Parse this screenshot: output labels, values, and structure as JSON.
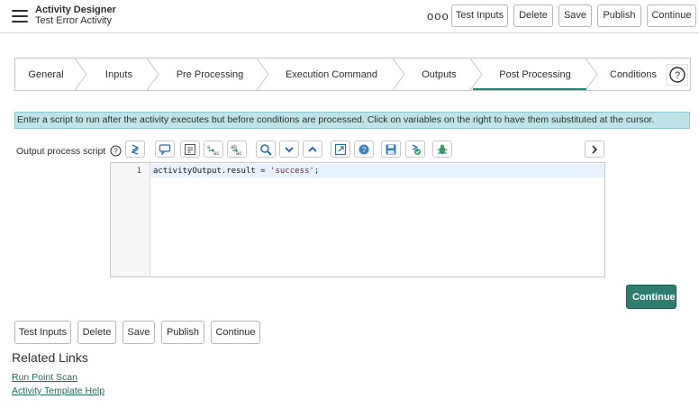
{
  "header": {
    "app_title": "Activity Designer",
    "record_title": "Test Error Activity",
    "more_label": "ooo",
    "buttons": {
      "test_inputs": "Test Inputs",
      "delete": "Delete",
      "save": "Save",
      "publish": "Publish",
      "continue": "Continue"
    }
  },
  "tabs": [
    {
      "label": "General"
    },
    {
      "label": "Inputs"
    },
    {
      "label": "Pre Processing"
    },
    {
      "label": "Execution Command"
    },
    {
      "label": "Outputs"
    },
    {
      "label": "Post Processing"
    },
    {
      "label": "Conditions"
    }
  ],
  "active_tab": "Post Processing",
  "info_text": "Enter a script to run after the activity executes but before conditions are processed. Click on variables on the right to have them substituted at the cursor.",
  "field": {
    "label": "Output process script"
  },
  "toolbar_icons": [
    "toggle-syntax-icon",
    "comment-icon",
    "format-icon",
    "replace-icon",
    "replace-all-icon",
    "search-icon",
    "next-icon",
    "previous-icon",
    "fullscreen-icon",
    "help-icon",
    "save-icon",
    "script-check-icon",
    "debug-icon",
    "expand-icon"
  ],
  "editor": {
    "line_number": "1",
    "code_prefix": "activityOutput.result = ",
    "code_string": "'success'",
    "code_suffix": ";"
  },
  "continue_primary": "Continue",
  "bottom_buttons": {
    "test_inputs": "Test Inputs",
    "delete": "Delete",
    "save": "Save",
    "publish": "Publish",
    "continue": "Continue"
  },
  "related": {
    "title": "Related Links",
    "links": [
      "Run Point Scan",
      "Activity Template Help"
    ]
  },
  "colors": {
    "accent": "#1f8476",
    "primary_button": "#2f7d6e",
    "info_background": "#bfe3e6",
    "link": "#1f6f5c"
  }
}
